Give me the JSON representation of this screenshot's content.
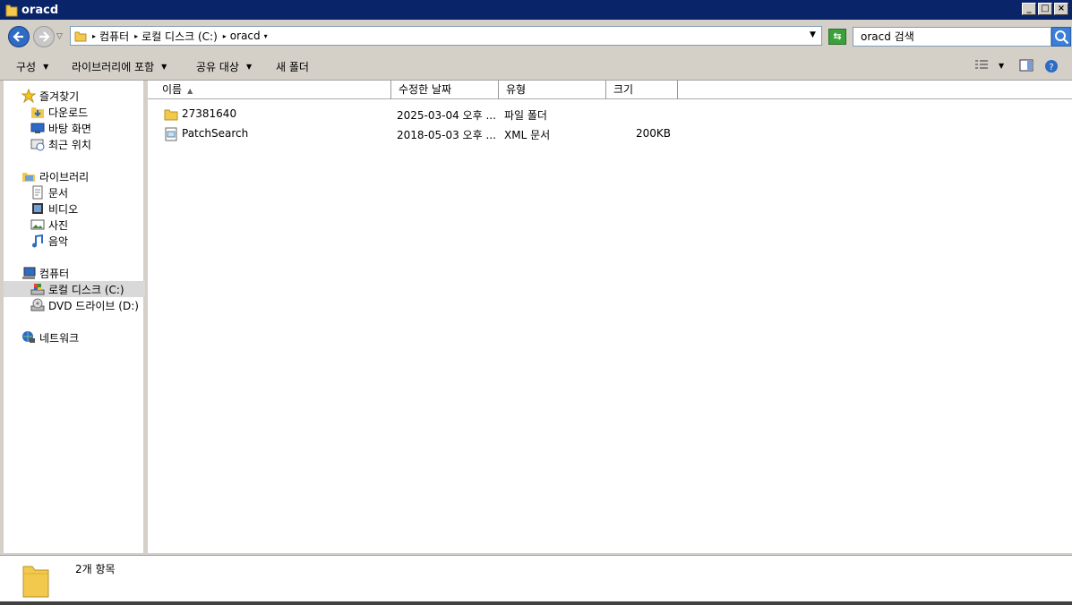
{
  "window": {
    "title": "oracd"
  },
  "address": {
    "crumbs": [
      "컴퓨터",
      "로컬 디스크 (C:)",
      "oracd"
    ]
  },
  "search": {
    "value": "oracd 검색"
  },
  "toolbar": {
    "organize": "구성",
    "include_library": "라이브러리에 포함",
    "share_with": "공유 대상",
    "new_folder": "새 폴더"
  },
  "sidebar": {
    "favorites": {
      "label": "즐겨찾기",
      "items": [
        {
          "label": "다운로드"
        },
        {
          "label": "바탕 화면"
        },
        {
          "label": "최근 위치"
        }
      ]
    },
    "libraries": {
      "label": "라이브러리",
      "items": [
        {
          "label": "문서"
        },
        {
          "label": "비디오"
        },
        {
          "label": "사진"
        },
        {
          "label": "음악"
        }
      ]
    },
    "computer": {
      "label": "컴퓨터",
      "items": [
        {
          "label": "로컬 디스크 (C:)"
        },
        {
          "label": "DVD 드라이브 (D:)"
        }
      ]
    },
    "network": {
      "label": "네트워크"
    }
  },
  "table": {
    "columns": [
      "이름",
      "수정한 날짜",
      "유형",
      "크기"
    ],
    "rows": [
      {
        "name": "27381640",
        "date": "2025-03-04 오후 ...",
        "type": "파일 폴더",
        "size": ""
      },
      {
        "name": "PatchSearch",
        "date": "2018-05-03 오후 ...",
        "type": "XML 문서",
        "size": "200KB"
      }
    ]
  },
  "status": {
    "count_text": "2개 항목"
  },
  "colors": {
    "titlebar": "#0a246a",
    "folder": "#f2c94c",
    "back_button": "#2d6bc4"
  }
}
